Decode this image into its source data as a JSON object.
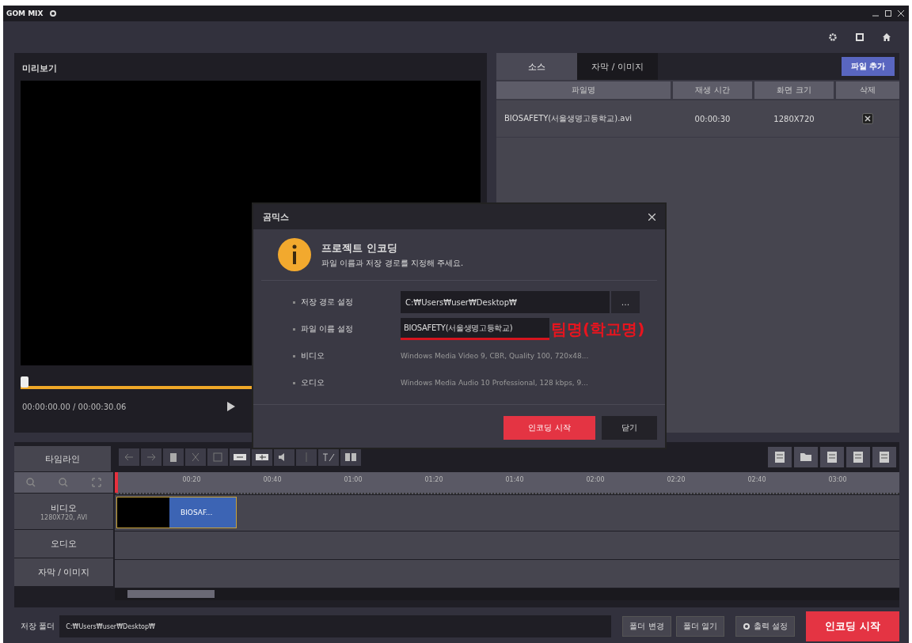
{
  "window": {
    "title": "GOM MIX"
  },
  "preview": {
    "title": "미리보기",
    "seek": {
      "level": 0
    },
    "time": "00:00:00.00 / 00:00:30.06"
  },
  "source_panel": {
    "tabs": [
      {
        "label": "소스",
        "selected": true
      },
      {
        "label": "자막 / 이미지",
        "selected": false
      }
    ],
    "add_button": "파일 추가",
    "columns": [
      "파일명",
      "재생 시간",
      "화면 크기",
      "삭제"
    ],
    "rows": [
      {
        "file": "BIOSAFETY(서울생명고등학교).avi",
        "duration": "00:00:30",
        "resolution": "1280X720"
      }
    ]
  },
  "timeline": {
    "title": "타임라인",
    "ticks": [
      "00:20",
      "00:40",
      "01:00",
      "01:20",
      "01:40",
      "02:00",
      "02:20",
      "02:40",
      "03:00"
    ],
    "tracks": [
      {
        "name": "비디오",
        "detail": "1280X720, AVI",
        "clip": "BIOSAF..."
      },
      {
        "name": "오디오"
      },
      {
        "name": "자막 / 이미지"
      }
    ]
  },
  "bottom": {
    "label": "저장 폴더",
    "path": "C:₩Users₩user₩Desktop₩",
    "buttons": [
      "폴더 변경",
      "폴더 열기",
      "출력 설정"
    ],
    "encode": "인코딩 시작"
  },
  "dialog": {
    "title": "곰믹스",
    "heading": "프로젝트 인코딩",
    "message": "파일 이름과 저장 경로를 지정해 주세요.",
    "fields": [
      {
        "kind": "input",
        "label": "저장 경로 설정",
        "value": "C:₩Users₩user₩Desktop₩",
        "browse": "..."
      },
      {
        "kind": "input",
        "label": "파일 이름 설정",
        "value": "BIOSAFETY(서울생명고등학교)",
        "annotation": "팀명(학교명)"
      },
      {
        "kind": "text",
        "label": "비디오",
        "value": "Windows Media Video 9, CBR, Quality 100, 720x48..."
      },
      {
        "kind": "text",
        "label": "오디오",
        "value": "Windows Media Audio 10 Professional, 128 kbps, 9..."
      }
    ],
    "buttons": [
      {
        "label": "인코딩 시작",
        "primary": true
      },
      {
        "label": "닫기",
        "primary": false
      }
    ]
  }
}
